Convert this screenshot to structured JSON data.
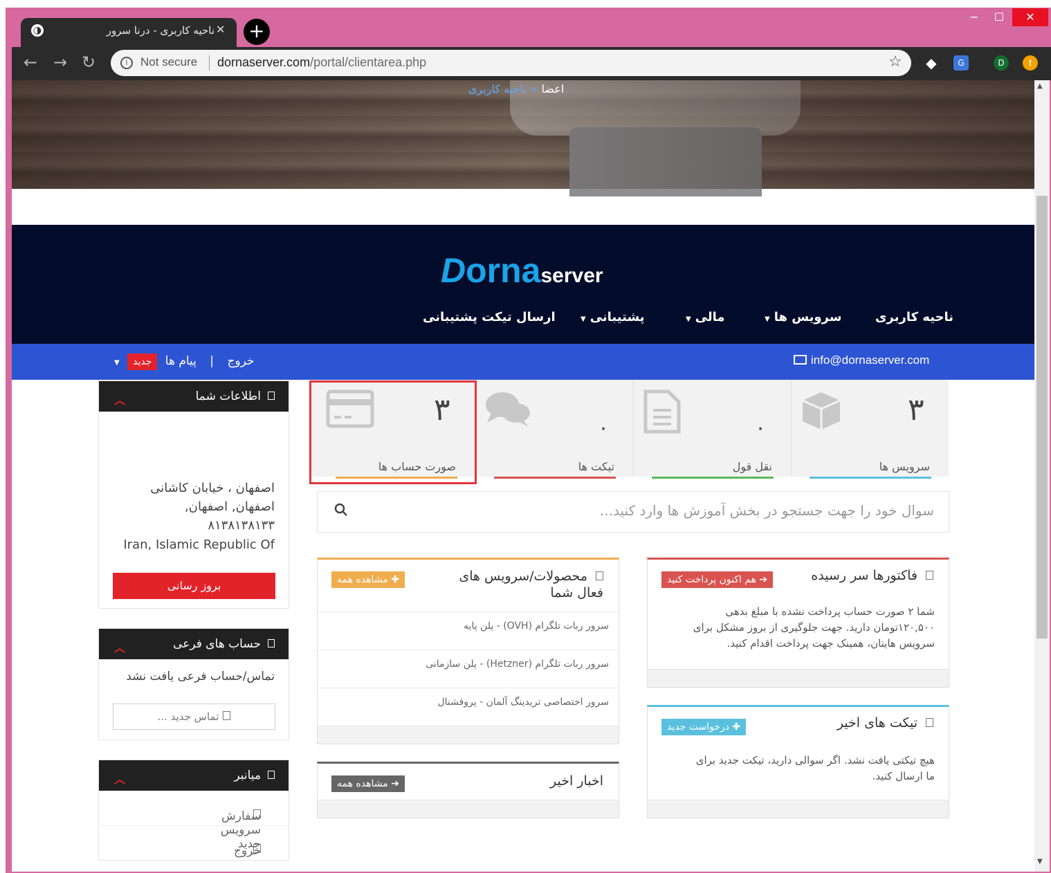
{
  "browser": {
    "tab_title": "ناحیه کاربری - درنا سرور",
    "tab_close": "✕",
    "new_tab": "+",
    "security_label": "Not secure",
    "url_host": "dornaserver.com",
    "url_path": "/portal/clientarea.php",
    "profile_initial": "D",
    "window_min": "−",
    "window_max": "☐",
    "window_close": "✕"
  },
  "breadcrumb": {
    "item1": "اعضا",
    "separator": "»",
    "item2": "ناحیه کاربری"
  },
  "logo": {
    "part1": "D",
    "part2": "orna",
    "part3": "server"
  },
  "main_nav": [
    {
      "label": "ناحیه کاربری"
    },
    {
      "label": "سرویس ها"
    },
    {
      "label": "مالی"
    },
    {
      "label": "پشتیبانی"
    },
    {
      "label": "ارسال تیکت پشتیبانی"
    }
  ],
  "topbar": {
    "email": "info@dornaserver.com",
    "logout": "خروج",
    "divider": "|",
    "messages": "پیام ها",
    "new_badge": "جدید"
  },
  "stats": [
    {
      "num": "۳",
      "label": "سرویس ها",
      "color": "#5bc0de"
    },
    {
      "num": "۰",
      "label": "نقل قول",
      "color": "#5cb85c"
    },
    {
      "num": "۰",
      "label": "تیکت ها",
      "color": "#d9534f"
    },
    {
      "num": "۳",
      "label": "صورت حساب ها",
      "color": "#f0ad4e"
    }
  ],
  "search": {
    "placeholder": "سوال خود را جهت جستجو در بخش آموزش ها وارد کنید..."
  },
  "invoices_panel": {
    "title": "فاکتورها سر رسیده",
    "button": "هم اکنون پرداخت کنید",
    "line1": "شما ۲ صورت حساب پرداخت نشده با مبلغ بدهی",
    "line2": "۱۲۰,۵۰۰تومان دارید. جهت جلوگیری از بروز مشکل برای",
    "line3": "سرویس هایتان، همینک جهت پرداخت اقدام کنید.",
    "accent": "#d9534f"
  },
  "services_panel": {
    "title_line1": "محصولات/سرویس های",
    "title_line2": "فعال شما",
    "button": "مشاهده همه",
    "items": [
      "سرور ربات تلگرام (OVH) - پلن پایه",
      "سرور ربات تلگرام (Hetzner) - پلن سازمانی",
      "سرور اختصاصی تریدینگ آلمان - پروفشنال"
    ],
    "accent": "#f0ad4e"
  },
  "tickets_panel": {
    "title": "تیکت های اخیر",
    "button": "درخواست جدید",
    "line1": "هیچ تیکتی یافت نشد. اگر سوالی دارید، تیکت جدید برای",
    "line2": "ما ارسال کنید.",
    "accent": "#5bc0de"
  },
  "news_panel": {
    "title": "اخبار اخیر",
    "button": "مشاهده همه",
    "accent": "#666666"
  },
  "sidebar": {
    "info": {
      "title": "اطلاعات شما",
      "address": [
        "اصفهان ، خیابان کاشانی",
        "اصفهان, اصفهان,",
        "۸۱۳۸۱۳۸۱۳۳",
        "Iran, Islamic Republic Of"
      ],
      "update_button": "بروز رسانی"
    },
    "subaccounts": {
      "title": "حساب های فرعی",
      "empty_text": "تماس/حساب فرعی یافت نشد",
      "new_contact": "تماس جدید ..."
    },
    "shortcuts": {
      "title": "میانبر",
      "items": [
        "سفارش سرویس جدید",
        "خروج"
      ]
    }
  },
  "colors": {
    "brand_blue": "#2d54d3",
    "header_navy": "#030d2b",
    "danger": "#e3232a"
  }
}
